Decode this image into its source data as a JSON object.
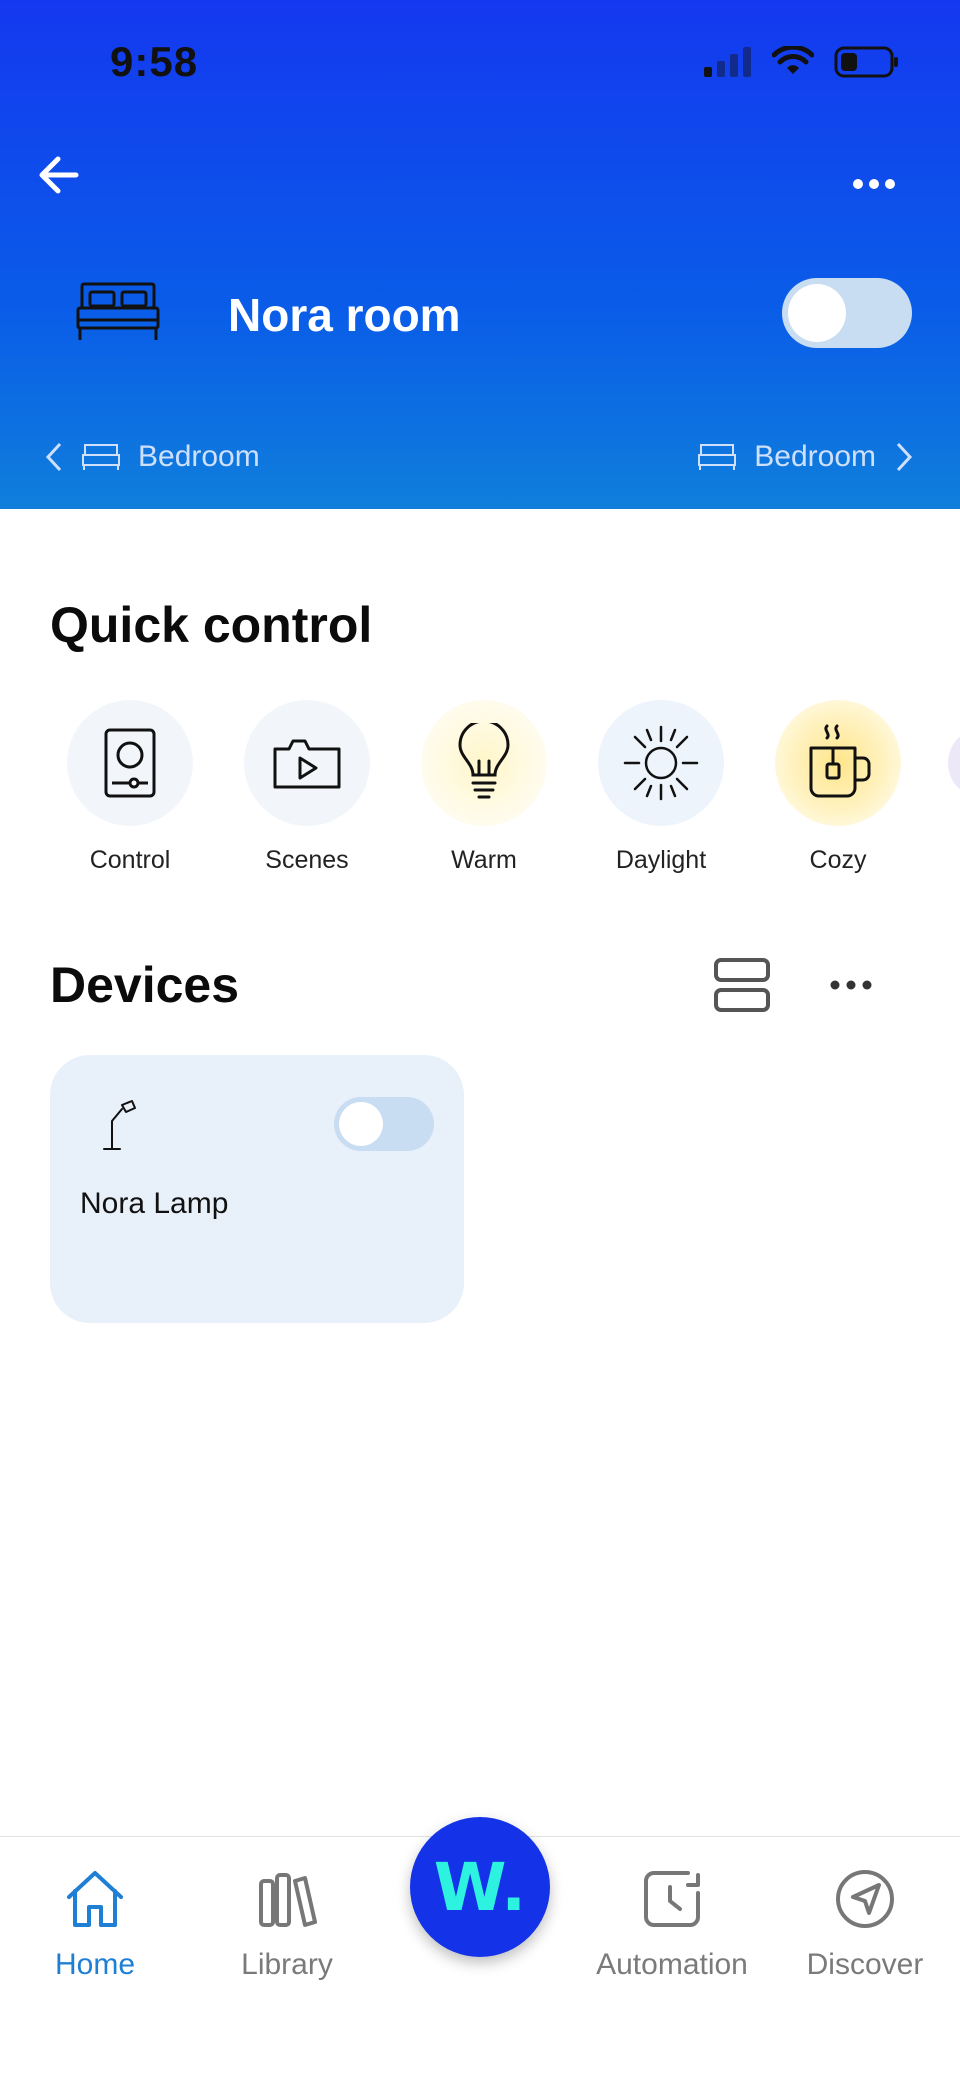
{
  "status_bar": {
    "time": "9:58"
  },
  "header": {
    "room_title": "Nora room",
    "room_on": false,
    "prev_room": "Bedroom",
    "next_room": "Bedroom",
    "bg_colors": [
      "#1438f0",
      "#0f7fdb"
    ]
  },
  "quick_control": {
    "title": "Quick control",
    "items": [
      {
        "label": "Control",
        "icon": "remote-icon"
      },
      {
        "label": "Scenes",
        "icon": "scenes-icon"
      },
      {
        "label": "Warm",
        "icon": "bulb-icon"
      },
      {
        "label": "Daylight",
        "icon": "sun-icon"
      },
      {
        "label": "Cozy",
        "icon": "tea-cup-icon"
      }
    ]
  },
  "devices": {
    "title": "Devices",
    "items": [
      {
        "name": "Nora Lamp",
        "icon": "desk-lamp-icon",
        "on": false
      }
    ]
  },
  "tabbar": {
    "tabs": [
      {
        "label": "Home",
        "icon": "home-icon",
        "active": true
      },
      {
        "label": "Library",
        "icon": "library-icon",
        "active": false
      },
      {
        "label": "Automation",
        "icon": "automation-icon",
        "active": false
      },
      {
        "label": "Discover",
        "icon": "discover-icon",
        "active": false
      }
    ],
    "center_label": "W."
  },
  "colors": {
    "accent": "#1e7fd4",
    "toggle_off": "#c9ddf2",
    "card_bg": "#e8f0fa"
  }
}
